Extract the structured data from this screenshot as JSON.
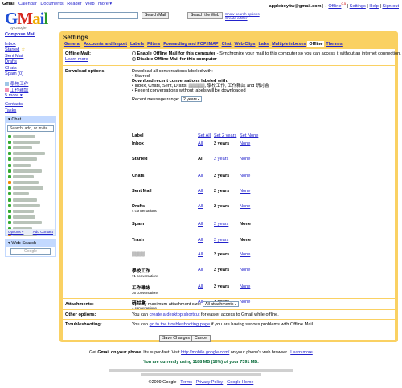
{
  "topbar": {
    "brand": "Gmail",
    "links": [
      "Calendar",
      "Documents",
      "Reader",
      "Web",
      "more ▾"
    ],
    "user_email": "appleboy.tw@gmail.com",
    "offline_label": "Offline",
    "offline_version": "0.5",
    "settings": "Settings",
    "help": "Help",
    "sign_out": "Sign out"
  },
  "logo": {
    "g": "G",
    "m": "M",
    "a": "a",
    "i": "i",
    "l": "l",
    "sub": "by Google"
  },
  "search": {
    "value": "",
    "search_mail": "Search Mail",
    "search_web": "Search the Web",
    "show_options": "Show search options",
    "create_filter": "Create a filter"
  },
  "nav": {
    "compose": "Compose Mail",
    "items": [
      "Inbox",
      "Starred",
      "Sent Mail",
      "Drafts",
      "Chats",
      "Spam (0)"
    ],
    "labels": [
      {
        "name": "學校工作",
        "color": "#9fc6e7"
      },
      {
        "name": "工作雜誌",
        "color": "#f691b2"
      }
    ],
    "more": "5 more ▾",
    "contacts": "Contacts",
    "tasks": "Tasks"
  },
  "chat": {
    "title": "Chat",
    "search_placeholder": "Search, add, or invite",
    "status_colors": [
      "#3a3",
      "#3a3",
      "#3a3",
      "#3a3",
      "#3a3",
      "#3a3",
      "#3a3",
      "#3a3",
      "#e80",
      "#3a3",
      "#3a3",
      "#3a3",
      "#3a3",
      "#3a3",
      "#3a3",
      "#3a3",
      "#3a3",
      "#e80",
      "#e80",
      "#3a3"
    ],
    "options": "Options ▾",
    "add_contact": "Add Contact"
  },
  "websearch": {
    "title": "Web Search",
    "google": "Google"
  },
  "settings": {
    "title": "Settings",
    "tabs": [
      "General",
      "Accounts and Import",
      "Labels",
      "Filters",
      "Forwarding and POP/IMAP",
      "Chat",
      "Web Clips",
      "Labs",
      "Multiple inboxes",
      "Offline",
      "Themes"
    ],
    "active_tab": "Offline",
    "offline_mail": {
      "label": "Offline Mail:",
      "learn_more": "Learn more",
      "enable": "Enable Offline Mail for this computer",
      "enable_desc": " - Synchronize your mail to this computer so you can access it without an internet connection.",
      "disable": "Disable Offline Mail for this computer"
    },
    "download": {
      "label": "Download options:",
      "line1": "Download all conversations labeled with:",
      "line1_items": [
        "Starred"
      ],
      "line2": "Download recent conversations labeled with:",
      "line2_items": [
        "Inbox, Chats, Sent, Drafts, ▒▒▒▒▒, 學校工作, 工作雜誌 and 研討會",
        "Recent conversations without labels will be downloaded"
      ],
      "range_label": "Recent message range:",
      "range_value": "2 years"
    },
    "label_table": {
      "headers": {
        "label": "Label",
        "set_all": "Set All",
        "set_2years": "Set 2 years",
        "set_none": "Set None"
      },
      "rows": [
        {
          "name": "Inbox",
          "count": "",
          "all": "All",
          "two": "2 years",
          "none": "None",
          "selected": "two"
        },
        {
          "name": "Starred",
          "count": "",
          "all": "All",
          "two": "2 years",
          "none": "None",
          "selected": "all"
        },
        {
          "name": "Chats",
          "count": "",
          "all": "All",
          "two": "2 years",
          "none": "None",
          "selected": "two"
        },
        {
          "name": "Sent Mail",
          "count": "",
          "all": "All",
          "two": "2 years",
          "none": "None",
          "selected": "two"
        },
        {
          "name": "Drafts",
          "count": "4 conversations",
          "all": "All",
          "two": "2 years",
          "none": "None",
          "selected": "two"
        },
        {
          "name": "Spam",
          "count": "",
          "all": "All",
          "two": "2 years",
          "none": "None",
          "selected": "none"
        },
        {
          "name": "Trash",
          "count": "",
          "all": "All",
          "two": "2 years",
          "none": "None",
          "selected": "none"
        },
        {
          "name": "▒▒▒▒",
          "count": "",
          "all": "All",
          "two": "2 years",
          "none": "None",
          "selected": "two"
        },
        {
          "name": "學校工作",
          "count": "71 conversations",
          "all": "All",
          "two": "2 years",
          "none": "None",
          "selected": "two"
        },
        {
          "name": "工作雜誌",
          "count": "36 conversations",
          "all": "All",
          "two": "2 years",
          "none": "None",
          "selected": "two"
        },
        {
          "name": "研討會",
          "count": "4 conversations",
          "all": "All",
          "two": "2 years",
          "none": "None",
          "selected": "two"
        }
      ]
    },
    "attachments": {
      "label": "Attachments:",
      "text": "Specify maximum attachment size:",
      "value": "All attachments"
    },
    "other": {
      "label": "Other options:",
      "pre": "You can ",
      "link": "create a desktop shortcut",
      "post": " for easier access to Gmail while offline."
    },
    "trouble": {
      "label": "Troubleshooting:",
      "pre": "You can ",
      "link": "go to the troubleshooting page",
      "post": " if you are having serious problems with Offline Mail."
    },
    "save": "Save Changes",
    "cancel": "Cancel"
  },
  "footer": {
    "phone_pre": "Get ",
    "phone_bold": "Gmail on your phone.",
    "phone_mid": " It's super-fast. Visit ",
    "phone_link": "http://mobile.google.com/",
    "phone_post": " on your phone's web browser.",
    "learn_more": "Learn more",
    "usage": "You are currently using 1188 MB (16%) of your 7391 MB.",
    "copyright": "©2009 Google - ",
    "terms": "Terms",
    "privacy": "Privacy Policy",
    "home": "Google Home"
  }
}
